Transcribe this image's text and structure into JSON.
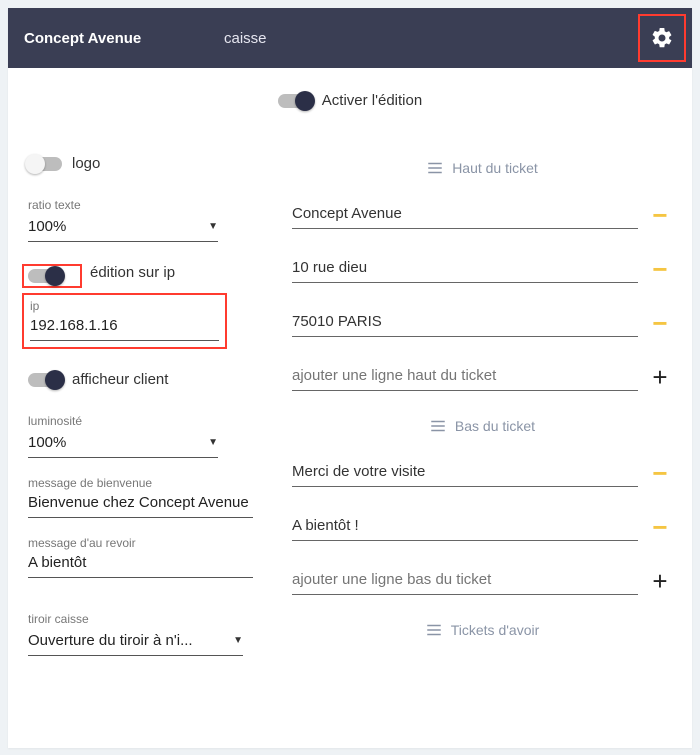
{
  "header": {
    "title": "Concept Avenue",
    "subtitle": "caisse"
  },
  "topToggle": {
    "label": "Activer l'édition"
  },
  "left": {
    "logo_label": "logo",
    "ratio_label": "ratio texte",
    "ratio_value": "100%",
    "edition_ip_label": "édition sur ip",
    "ip_label": "ip",
    "ip_value": "192.168.1.16",
    "afficheur_label": "afficheur client",
    "luminosite_label": "luminosité",
    "luminosite_value": "100%",
    "bienvenue_label": "message de bienvenue",
    "bienvenue_value": "Bienvenue chez Concept Avenue",
    "aurevoir_label": "message d'au revoir",
    "aurevoir_value": "A bientôt",
    "tiroir_label": "tiroir caisse",
    "tiroir_value": "Ouverture du tiroir à n'i..."
  },
  "right": {
    "haut_heading": "Haut du ticket",
    "haut_lines": {
      "0": "Concept Avenue",
      "1": "10 rue dieu",
      "2": "75010 PARIS"
    },
    "haut_add": "ajouter une ligne haut du ticket",
    "bas_heading": "Bas du ticket",
    "bas_lines": {
      "0": "Merci de votre visite",
      "1": "A bientôt !"
    },
    "bas_add": "ajouter une ligne bas du ticket",
    "avoir_heading": "Tickets d'avoir"
  }
}
